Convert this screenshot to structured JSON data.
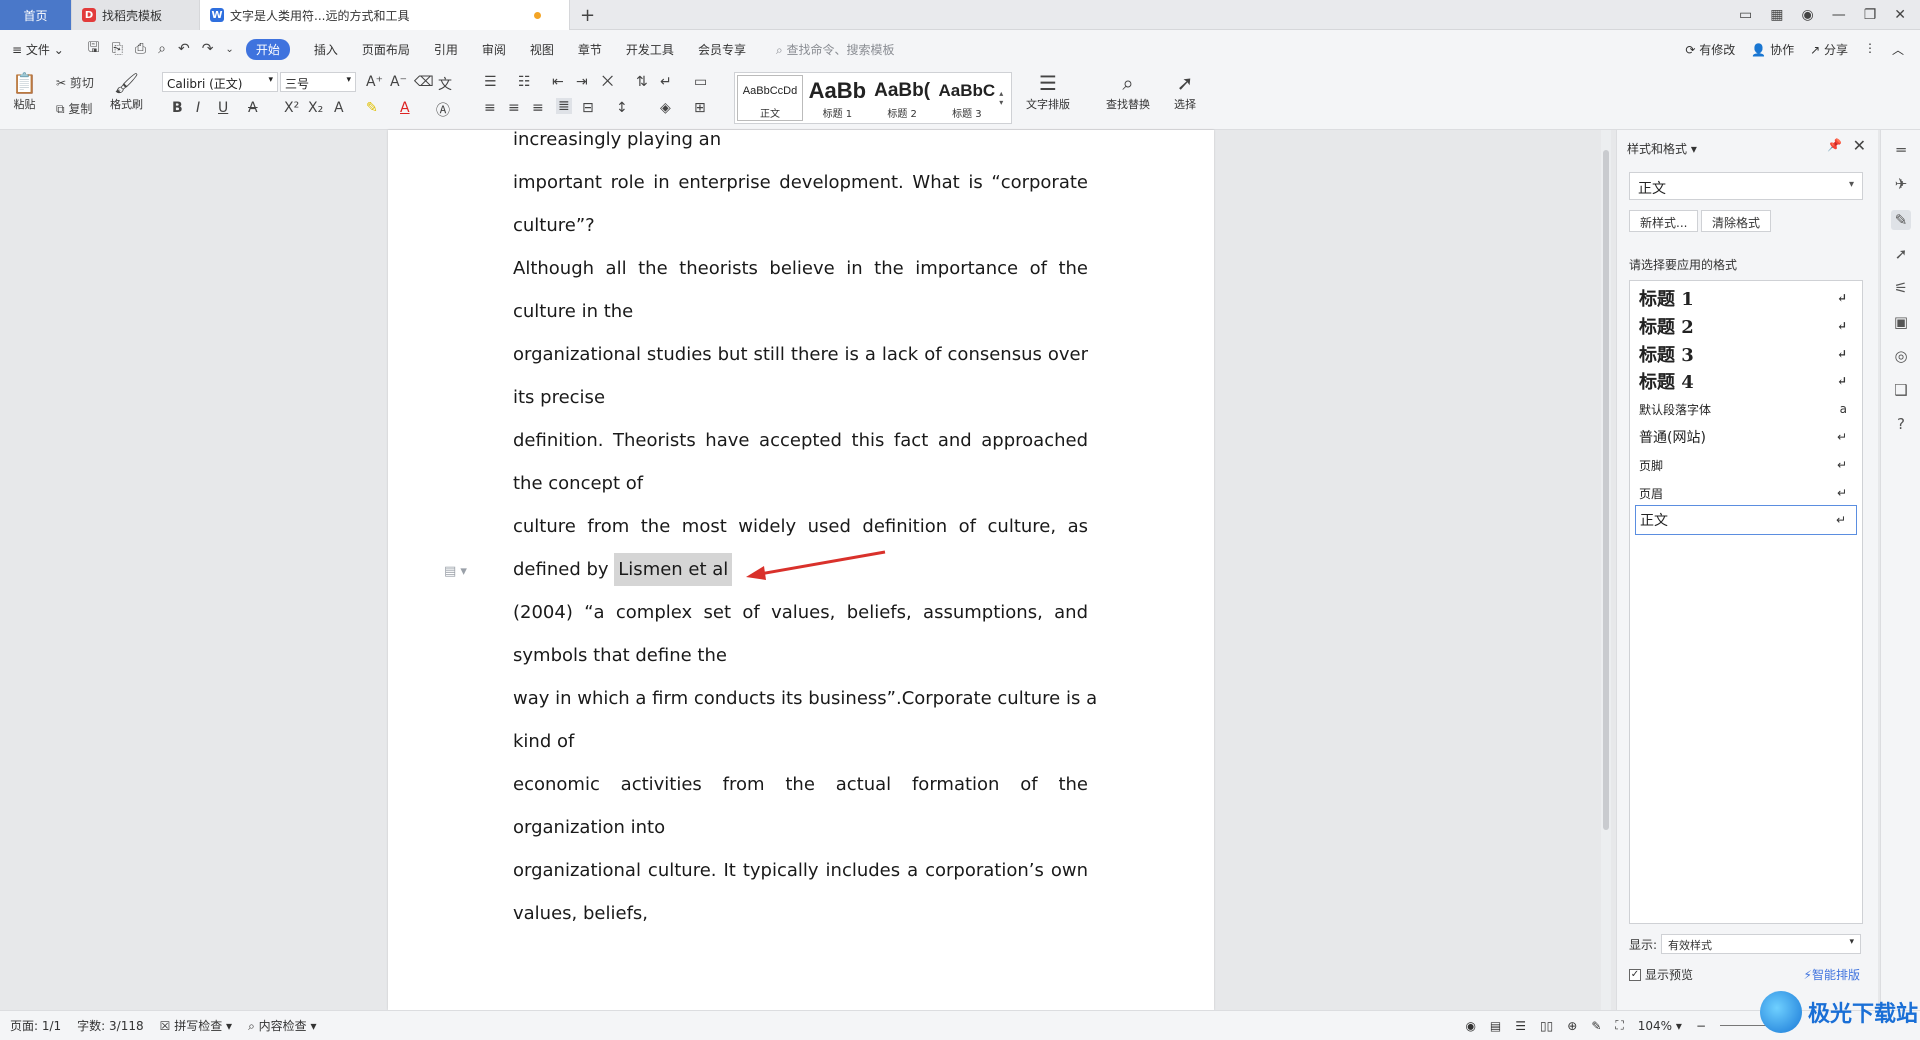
{
  "tabs": {
    "home": "首页",
    "template": "找稻壳模板",
    "document": "文字是人类用符...远的方式和工具"
  },
  "menu": {
    "file": "文件",
    "items": [
      "开始",
      "插入",
      "页面布局",
      "引用",
      "审阅",
      "视图",
      "章节",
      "开发工具",
      "会员专享"
    ],
    "search_placeholder": "查找命令、搜索模板",
    "right": [
      "有修改",
      "协作",
      "分享"
    ]
  },
  "ribbon": {
    "paste": "粘贴",
    "cut": "剪切",
    "copy": "复制",
    "format_painter": "格式刷",
    "font_name": "Calibri (正文)",
    "font_size": "三号",
    "styles": [
      {
        "preview": "AaBbCcDd",
        "label": "正文"
      },
      {
        "preview": "AaBb",
        "label": "标题 1"
      },
      {
        "preview": "AaBb(",
        "label": "标题 2"
      },
      {
        "preview": "AaBbC",
        "label": "标题 3"
      }
    ],
    "text_layout": "文字排版",
    "find_replace": "查找替换",
    "select": "选择"
  },
  "document": {
    "lines": [
      {
        "text": "increasingly playing an",
        "justify": false
      },
      {
        "text": "important role in enterprise development. What is “corporate",
        "justify": true
      },
      {
        "text": "culture”?",
        "justify": false
      },
      {
        "text": "Although all the theorists believe in the importance of the",
        "justify": true
      },
      {
        "text": "culture in the",
        "justify": false
      },
      {
        "text": "organizational studies but still there is a lack of consensus over",
        "justify": true
      },
      {
        "text": "its precise",
        "justify": false
      },
      {
        "text": "definition. Theorists have accepted this fact and approached",
        "justify": true
      },
      {
        "text": "the concept of",
        "justify": false
      },
      {
        "text": "culture from the most widely used definition of culture, as",
        "justify": true
      },
      {
        "text": "",
        "justify": false
      },
      {
        "text": "(2004) “a complex set of values, beliefs, assumptions, and",
        "justify": true
      },
      {
        "text": "symbols that define the",
        "justify": false
      },
      {
        "text": "way in which a firm conducts its business”.Corporate culture is a",
        "justify": true
      },
      {
        "text": "kind of",
        "justify": false
      },
      {
        "text": "economic activities from the actual formation of the",
        "justify": true
      },
      {
        "text": "organization into",
        "justify": false
      },
      {
        "text": "organizational culture. It typically includes a corporation’s own",
        "justify": true
      },
      {
        "text": "values, beliefs,",
        "justify": false
      }
    ],
    "selected_line_prefix": "defined by ",
    "selected_text": "Lismen et al"
  },
  "style_pane": {
    "title": "样式和格式",
    "current_style": "正文",
    "new_style": "新样式...",
    "clear_format": "清除格式",
    "choose_label": "请选择要应用的格式",
    "styles": [
      {
        "name": "标题  1",
        "mark": "↵",
        "heading": true
      },
      {
        "name": "标题  2",
        "mark": "↵",
        "heading": true
      },
      {
        "name": "标题  3",
        "mark": "↵",
        "heading": true
      },
      {
        "name": "标题  4",
        "mark": "↵",
        "heading": true
      },
      {
        "name": "默认段落字体",
        "mark": "a",
        "heading": false
      },
      {
        "name": "普通(网站)",
        "mark": "↵",
        "heading": false
      },
      {
        "name": "页脚",
        "mark": "↵",
        "heading": false
      },
      {
        "name": "页眉",
        "mark": "↵",
        "heading": false
      },
      {
        "name": "正文",
        "mark": "↵",
        "heading": false
      }
    ],
    "show_label": "显示:",
    "show_value": "有效样式",
    "show_preview": "显示预览",
    "smart_layout": "智能排版"
  },
  "status": {
    "page": "页面: 1/1",
    "word_count": "字数: 3/118",
    "spell_check": "拼写检查",
    "content_check": "内容检查",
    "zoom": "104%"
  },
  "watermark": "极光下载站"
}
